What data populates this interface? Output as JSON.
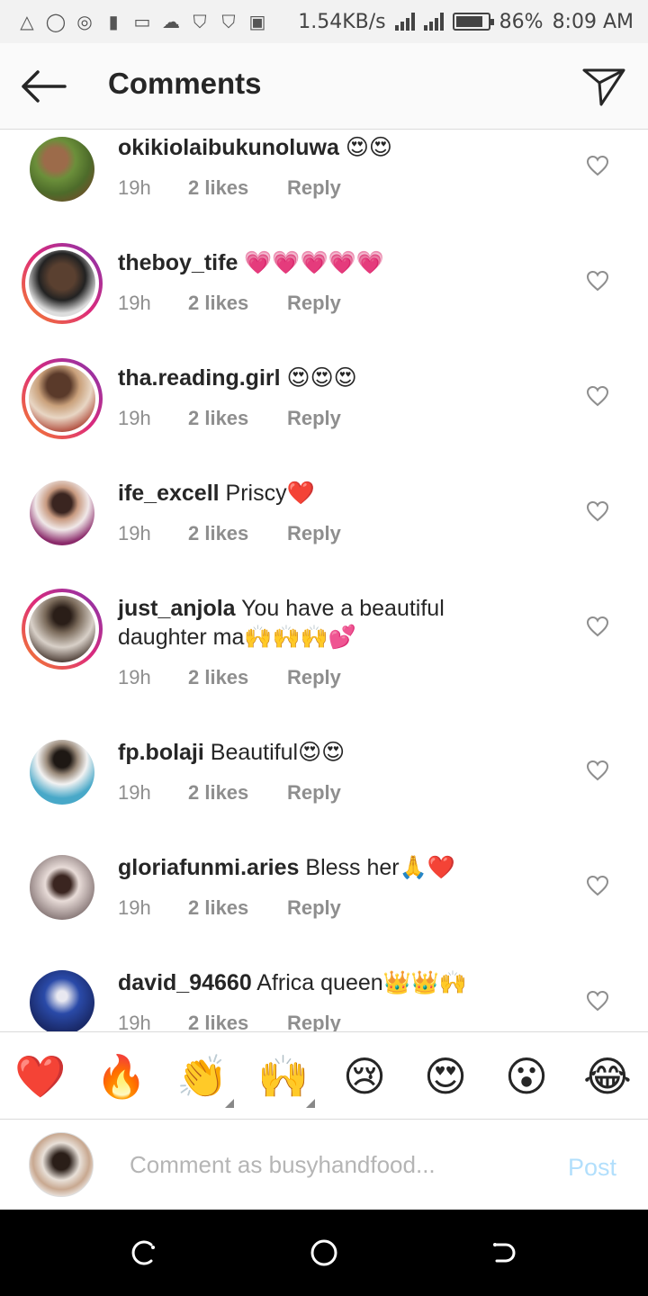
{
  "status_bar": {
    "speed": "1.54KB/s",
    "battery": "86%",
    "time": "8:09 AM",
    "battery_level": 0.86
  },
  "header": {
    "title": "Comments"
  },
  "comments": [
    {
      "username": "okikiolaibukunoluwa",
      "text": " 😍😍",
      "time": "19h",
      "likes": "2 likes",
      "reply": "Reply"
    },
    {
      "username": "theboy_tife",
      "text": " 💗💗💗💗💗",
      "time": "19h",
      "likes": "2 likes",
      "reply": "Reply"
    },
    {
      "username": "tha.reading.girl",
      "text": " 😍😍😍",
      "time": "19h",
      "likes": "2 likes",
      "reply": "Reply"
    },
    {
      "username": "ife_excell",
      "text": " Priscy❤️",
      "time": "19h",
      "likes": "2 likes",
      "reply": "Reply"
    },
    {
      "username": "just_anjola",
      "text": " You have a beautiful daughter ma🙌🙌🙌💕",
      "time": "19h",
      "likes": "2 likes",
      "reply": "Reply"
    },
    {
      "username": "fp.bolaji",
      "text": " Beautiful😍😍",
      "time": "19h",
      "likes": "2 likes",
      "reply": "Reply"
    },
    {
      "username": "gloriafunmi.aries",
      "text": " Bless her🙏❤️",
      "time": "19h",
      "likes": "2 likes",
      "reply": "Reply"
    },
    {
      "username": "david_94660",
      "text": " Africa queen👑👑🙌",
      "time": "19h",
      "likes": "2 likes",
      "reply": "Reply"
    }
  ],
  "quick_emojis": [
    "❤️",
    "🔥",
    "👏",
    "🙌",
    "😢",
    "😍",
    "😮",
    "😂"
  ],
  "composer": {
    "placeholder": "Comment as busyhandfood...",
    "post_label": "Post"
  },
  "colors": {
    "accent_disabled": "#b2dffc",
    "meta_gray": "#8e8e8e",
    "story_ring": "#dd2a7b"
  }
}
